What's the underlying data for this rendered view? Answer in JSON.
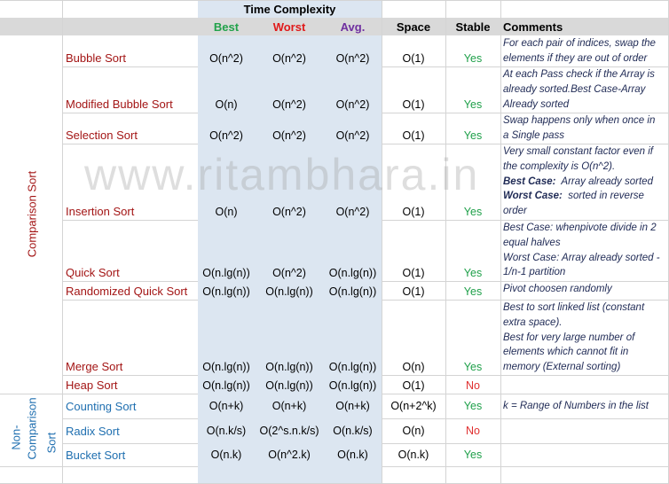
{
  "header": {
    "time_complexity": "Time Complexity",
    "best": "Best",
    "worst": "Worst",
    "avg": "Avg.",
    "space": "Space",
    "stable": "Stable",
    "comments": "Comments"
  },
  "groups": {
    "comparison": "Comparison Sort",
    "non_comparison_1": "Non-",
    "non_comparison_2": "Comparison",
    "non_comparison_3": "Sort"
  },
  "rows": [
    {
      "name": "Bubble Sort",
      "best": "O(n^2)",
      "worst": "O(n^2)",
      "avg": "O(n^2)",
      "space": "O(1)",
      "stable": "Yes",
      "comment": [
        "For each pair of indices, swap the",
        "elements if they are out of order"
      ]
    },
    {
      "name": "Modified Bubble Sort",
      "best": "O(n)",
      "worst": "O(n^2)",
      "avg": "O(n^2)",
      "space": "O(1)",
      "stable": "Yes",
      "comment": [
        "At each Pass check if the Array is",
        "already sorted.Best Case-Array",
        "Already sorted"
      ]
    },
    {
      "name": "Selection Sort",
      "best": "O(n^2)",
      "worst": "O(n^2)",
      "avg": "O(n^2)",
      "space": "O(1)",
      "stable": "Yes",
      "comment": [
        "Swap happens only when once in",
        "a Single pass"
      ]
    },
    {
      "name": "Insertion Sort",
      "best": "O(n)",
      "worst": "O(n^2)",
      "avg": "O(n^2)",
      "space": "O(1)",
      "stable": "Yes",
      "comment": [
        "Very small constant factor even if",
        "the complexity is O(n^2)."
      ],
      "best_case_label": "Best Case:",
      "best_case_text": "Array already sorted",
      "worst_case_label": "Worst Case:",
      "worst_case_text": "sorted in reverse",
      "worst_case_text2": "order"
    },
    {
      "name": "Quick Sort",
      "best": "O(n.lg(n))",
      "worst": "O(n^2)",
      "avg": "O(n.lg(n))",
      "space": "O(1)",
      "stable": "Yes",
      "comment": [
        "Best Case: whenpivote divide in 2",
        "equal halves",
        "Worst Case: Array already sorted -",
        "1/n-1 partition"
      ]
    },
    {
      "name": "Randomized Quick Sort",
      "best": "O(n.lg(n))",
      "worst": "O(n.lg(n))",
      "avg": "O(n.lg(n))",
      "space": "O(1)",
      "stable": "Yes",
      "comment": [
        "Pivot choosen randomly"
      ]
    },
    {
      "name": "Merge Sort",
      "best": "O(n.lg(n))",
      "worst": "O(n.lg(n))",
      "avg": "O(n.lg(n))",
      "space": "O(n)",
      "stable": "Yes",
      "comment": [
        "Best to sort linked list (constant",
        "extra space).",
        "Best for very large number of",
        "elements which cannot fit in",
        "memory (External sorting)"
      ]
    },
    {
      "name": "Heap Sort",
      "best": "O(n.lg(n))",
      "worst": "O(n.lg(n))",
      "avg": "O(n.lg(n))",
      "space": "O(1)",
      "stable": "No",
      "comment": []
    },
    {
      "name": "Counting Sort",
      "best": "O(n+k)",
      "worst": "O(n+k)",
      "avg": "O(n+k)",
      "space": "O(n+2^k)",
      "stable": "Yes",
      "comment": [
        "k = Range of Numbers in the list"
      ]
    },
    {
      "name": "Radix Sort",
      "best": "O(n.k/s)",
      "worst": "O(2^s.n.k/s)",
      "avg": "O(n.k/s)",
      "space": "O(n)",
      "stable": "No",
      "comment": []
    },
    {
      "name": "Bucket Sort",
      "best": "O(n.k)",
      "worst": "O(n^2.k)",
      "avg": "O(n.k)",
      "space": "O(n.k)",
      "stable": "Yes",
      "comment": []
    }
  ],
  "watermark": "www.ritambhara.in",
  "colors": {
    "best": "#21a24a",
    "worst": "#e01a1a",
    "avg": "#7030a0",
    "comparison": "#a31515",
    "non_comparison": "#1f6fb0",
    "yes": "#1fa04a",
    "no": "#e03030",
    "time_bg": "#dce6f1",
    "header_band": "#d9d9d9"
  }
}
